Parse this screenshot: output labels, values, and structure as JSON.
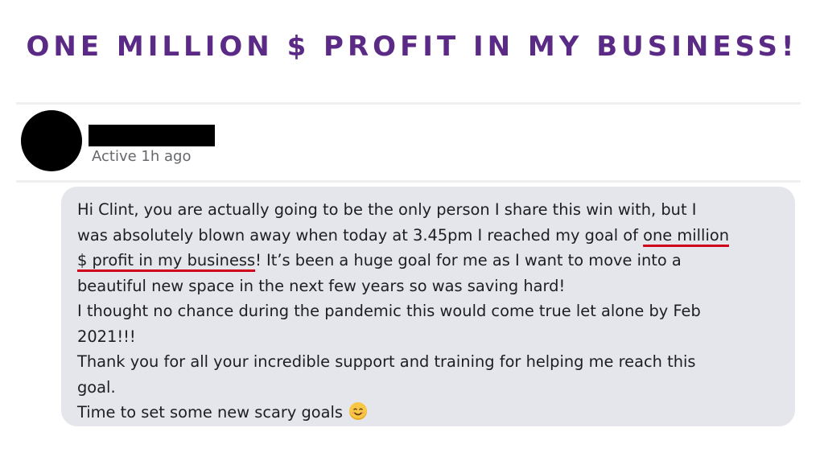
{
  "headline": "ONE MILLION $ PROFIT IN MY BUSINESS!",
  "colors": {
    "headline": "#5b2a86",
    "bubble_background": "#e4e6eb",
    "underline": "#d0021b",
    "status_text": "#65676b"
  },
  "contact": {
    "avatar_icon": "redacted-avatar",
    "status": "Active 1h ago"
  },
  "message": {
    "line1": "Hi Clint, you are actually going to be the only person I share this win with, but I",
    "line2_prefix": "was absolutely blown away when today at 3.45pm I reached my goal of ",
    "line2_highlight": "one million",
    "line3_highlight": "$ profit in my business",
    "line3_suffix": "! It’s been a huge goal for me as I want to move into a",
    "line4": "beautiful new space in the next few years so was saving hard!",
    "line5": "I thought no chance during the pandemic this would come true let alone by Feb",
    "line6": "2021!!!",
    "line7": "Thank you for all your incredible support and training for helping me reach this",
    "line8": "goal.",
    "line9": "Time to set some new scary goals",
    "emoji_icon": "smiling-face-emoji"
  }
}
